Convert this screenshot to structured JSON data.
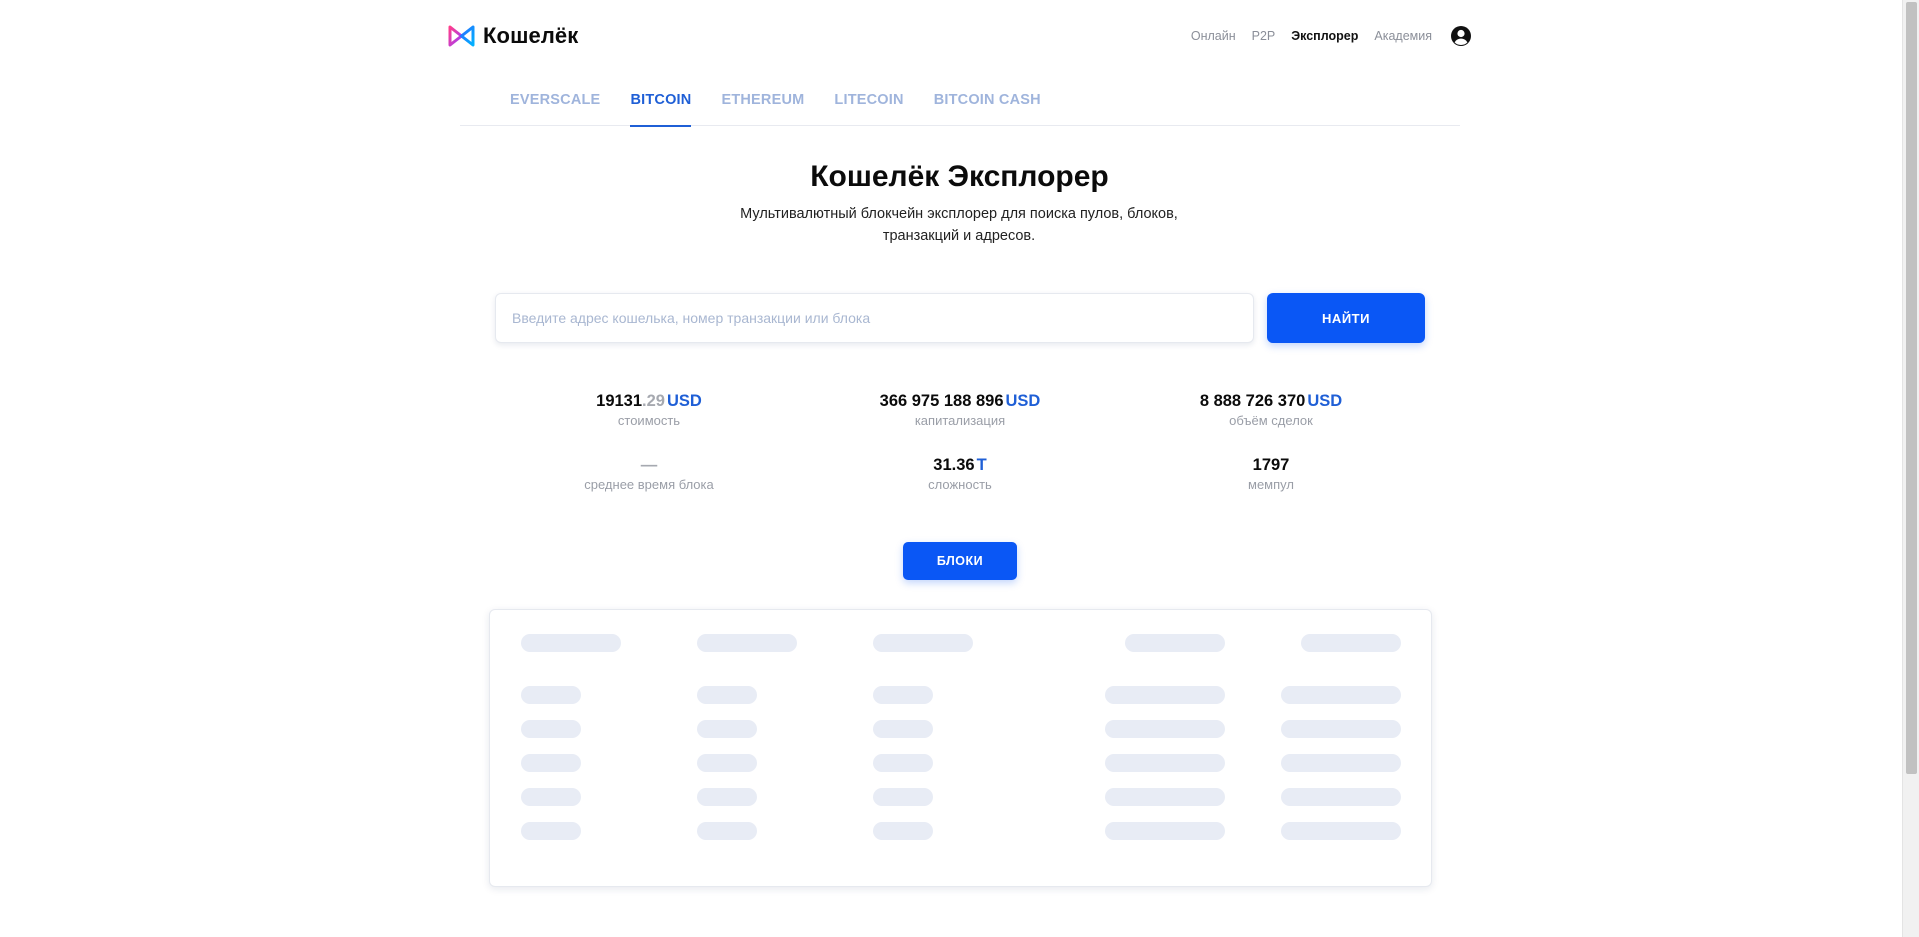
{
  "brand": {
    "name": "Кошелёк",
    "logo_icon": "koshelek-logo-icon"
  },
  "nav": {
    "items": [
      {
        "label": "Онлайн",
        "active": false
      },
      {
        "label": "P2P",
        "active": false
      },
      {
        "label": "Эксплорер",
        "active": true
      },
      {
        "label": "Академия",
        "active": false
      }
    ],
    "user_icon": "user-circle-icon"
  },
  "tabs": [
    {
      "label": "EVERSCALE",
      "active": false
    },
    {
      "label": "BITCOIN",
      "active": true
    },
    {
      "label": "ETHEREUM",
      "active": false
    },
    {
      "label": "LITECOIN",
      "active": false
    },
    {
      "label": "BITCOIN CASH",
      "active": false
    }
  ],
  "hero": {
    "title": "Кошелёк Эксплорер",
    "subtitle_line1": "Мультивалютный блокчейн эксплорер для поиска пулов, блоков,",
    "subtitle_line2": "транзакций и адресов."
  },
  "search": {
    "value": "",
    "placeholder": "Введите адрес кошелька, номер транзакции или блока",
    "button_label": "НАЙТИ"
  },
  "stats": {
    "price": {
      "main": "19131",
      "fraction": ".29",
      "unit": "USD",
      "label": "стоимость"
    },
    "market_cap": {
      "main": "366 975 188 896",
      "unit": "USD",
      "label": "капитализация"
    },
    "volume": {
      "main": "8 888 726 370",
      "unit": "USD",
      "label": "объём сделок"
    },
    "block_time": {
      "main": "—",
      "label": "среднее время блока"
    },
    "difficulty": {
      "main": "31.36",
      "unit": "T",
      "label": "сложность"
    },
    "mempool": {
      "main": "1797",
      "label": "мемпул"
    }
  },
  "blocks_button_label": "БЛОКИ",
  "colors": {
    "accent": "#0a57f5",
    "active_tab": "#1f5fd6",
    "inactive_tab": "#9fb4dc",
    "skeleton": "#e8ecf5"
  }
}
